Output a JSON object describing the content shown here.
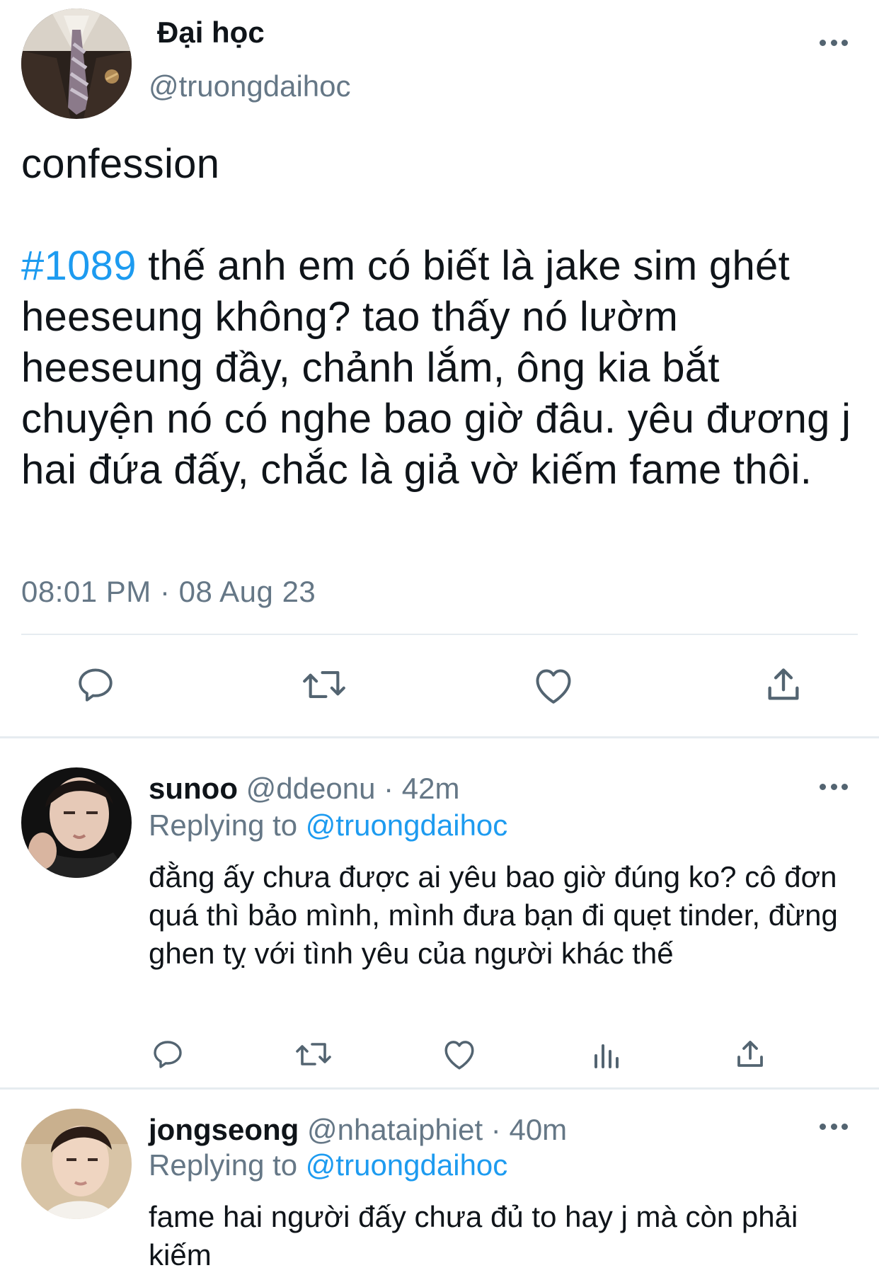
{
  "main_tweet": {
    "display_name": "Đại học",
    "handle": "@truongdaihoc",
    "text_line1": "confession",
    "hashtag": "#1089",
    "text_body": " thế anh em có biết là jake sim ghét heeseung không? tao thấy nó lườm heeseung đầy, chảnh lắm, ông kia bắt chuyện nó có nghe bao giờ đâu. yêu đương j hai đứa đấy, chắc là giả vờ kiếm fame thôi.",
    "timestamp": "08:01 PM · 08 Aug 23",
    "actions": [
      "reply-icon",
      "retweet-icon",
      "like-icon",
      "share-icon"
    ]
  },
  "replies": [
    {
      "display_name": "sunoo",
      "handle_time": " @ddeonu · 42m",
      "replying_prefix": "Replying to ",
      "replying_to": "@truongdaihoc",
      "text": "đằng ấy chưa được ai yêu bao giờ đúng ko? cô đơn quá thì bảo mình, mình đưa bạn đi quẹt tinder, đừng ghen tỵ với tình yêu của người khác thế",
      "actions": [
        "reply-icon",
        "retweet-icon",
        "like-icon",
        "analytics-icon",
        "share-icon"
      ]
    },
    {
      "display_name": "jongseong",
      "handle_time": " @nhataiphiet · 40m",
      "replying_prefix": "Replying to ",
      "replying_to": "@truongdaihoc",
      "text": "fame hai người đấy chưa đủ to hay j mà còn phải kiếm"
    }
  ],
  "colors": {
    "accent": "#1d9bf0",
    "secondary_text": "#657786",
    "icon": "#536471",
    "divider": "#e6ecf0"
  }
}
